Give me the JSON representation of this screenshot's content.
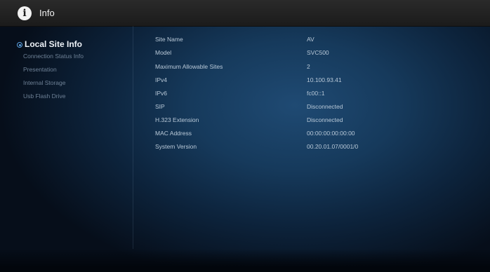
{
  "header": {
    "icon": "info-icon",
    "title": "Info"
  },
  "sidebar": {
    "items": [
      {
        "label": "Local Site Info",
        "active": true
      },
      {
        "label": "Connection Status Info",
        "active": false
      },
      {
        "label": "Presentation",
        "active": false
      },
      {
        "label": "Internal Storage",
        "active": false
      },
      {
        "label": "Usb Flash Drive",
        "active": false
      }
    ]
  },
  "info": {
    "rows": [
      {
        "label": "Site Name",
        "value": "AV"
      },
      {
        "label": "Model",
        "value": "SVC500"
      },
      {
        "label": "Maximum Allowable Sites",
        "value": "2"
      },
      {
        "label": "IPv4",
        "value": "10.100.93.41"
      },
      {
        "label": "IPv6",
        "value": "fc00::1"
      },
      {
        "label": "SIP",
        "value": "Disconnected"
      },
      {
        "label": "H.323 Extension",
        "value": "Disconnected"
      },
      {
        "label": "MAC Address",
        "value": "00:00:00:00:00:00"
      },
      {
        "label": "System Version",
        "value": "00.20.01.07/0001/0"
      }
    ]
  },
  "colors": {
    "accent": "#5aa0e0",
    "background": "#163a5c",
    "text": "#b9c9d8"
  }
}
